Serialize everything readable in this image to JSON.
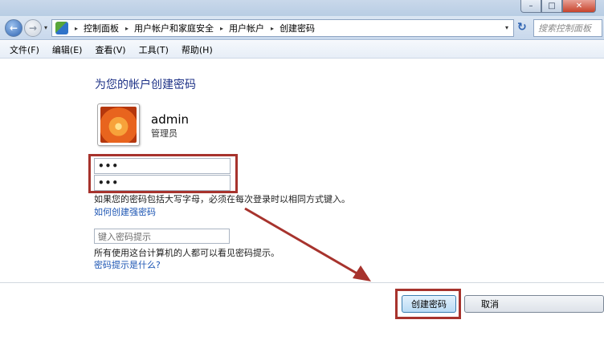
{
  "window": {
    "minimize": "–",
    "maximize": "□",
    "close": "✕"
  },
  "nav": {
    "back": "←",
    "forward": "→",
    "dropdown": "▾",
    "breadcrumbs": [
      "控制面板",
      "用户帐户和家庭安全",
      "用户帐户",
      "创建密码"
    ],
    "breadcrumb_separator": "▸",
    "refresh": "↻",
    "search_placeholder": "搜索控制面板"
  },
  "menu": [
    "文件(F)",
    "编辑(E)",
    "查看(V)",
    "工具(T)",
    "帮助(H)"
  ],
  "content": {
    "heading": "为您的帐户创建密码",
    "user_name": "admin",
    "user_role": "管理员",
    "password_value": "•••",
    "confirm_value": "•••",
    "case_note": "如果您的密码包括大写字母，必须在每次登录时以相同方式键入。",
    "strong_password_link": "如何创建强密码",
    "hint_placeholder": "键入密码提示",
    "hint_note": "所有使用这台计算机的人都可以看见密码提示。",
    "hint_link": "密码提示是什么?"
  },
  "buttons": {
    "create": "创建密码",
    "cancel": "取消"
  },
  "colors": {
    "annotation_red": "#a7332d",
    "link_blue": "#1c55b3",
    "heading_blue": "#1e3287"
  }
}
